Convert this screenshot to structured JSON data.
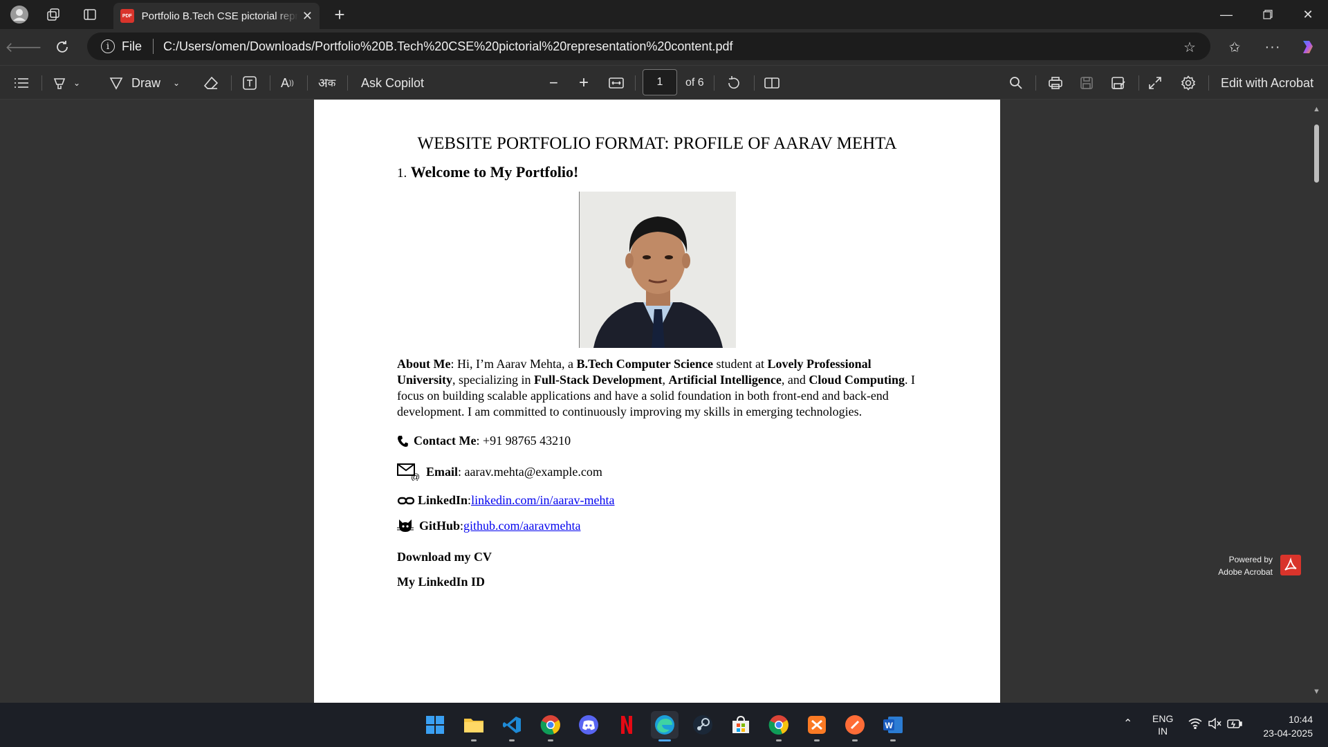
{
  "browser": {
    "tab_title": "Portfolio B.Tech CSE pictorial representation content.pdf",
    "address_scheme": "File",
    "address_url": "C:/Users/omen/Downloads/Portfolio%20B.Tech%20CSE%20pictorial%20representation%20content.pdf"
  },
  "pdf_toolbar": {
    "draw_label": "Draw",
    "ask_copilot_label": "Ask Copilot",
    "page_current": "1",
    "page_total_label": "of 6",
    "edit_acrobat_label": "Edit with Acrobat"
  },
  "document": {
    "title": "WEBSITE PORTFOLIO FORMAT: PROFILE OF AARAV MEHTA",
    "section1_number": "1.",
    "section1_heading": "Welcome to My Portfolio!",
    "about": {
      "label": "About Me",
      "t1": ": Hi, I’m Aarav Mehta, a ",
      "b1": "B.Tech Computer Science",
      "t2": " student at ",
      "b2": "Lovely Professional University",
      "t3": ", specializing in ",
      "b3": "Full-Stack Development",
      "t4": ", ",
      "b4": "Artificial Intelligence",
      "t5": ", and ",
      "b5": "Cloud Computing",
      "t6": ". I focus on building scalable applications and have a solid foundation in both front-end and back-end development. I am committed to continuously improving my skills in emerging technologies."
    },
    "contact": {
      "label": "Contact Me",
      "value": ": +91 98765 43210"
    },
    "email": {
      "label": "Email",
      "value": ": aarav.mehta@example.com"
    },
    "linkedin": {
      "label": "LinkedIn",
      "sep": ": ",
      "link": "linkedin.com/in/aarav-mehta"
    },
    "github": {
      "label": "GitHub",
      "sep": ": ",
      "link": "github.com/aaravmehta"
    },
    "download_cv": "Download my CV",
    "my_linkedin_id": "My LinkedIn ID"
  },
  "powered_by": {
    "line1": "Powered by",
    "line2": "Adobe Acrobat"
  },
  "taskbar": {
    "lang_line1": "ENG",
    "lang_line2": "IN",
    "time": "10:44",
    "date": "23-04-2025"
  },
  "icons": [
    "profile-icon",
    "workspaces-icon",
    "tab-actions-icon",
    "pdf-icon",
    "close-icon",
    "new-tab-icon",
    "back-icon",
    "refresh-icon",
    "info-icon",
    "favorite-star-icon",
    "favorites-icon",
    "more-icon",
    "copilot-icon",
    "contents-icon",
    "highlight-icon",
    "draw-icon",
    "eraser-icon",
    "text-box-icon",
    "read-aloud-icon",
    "translate-icon",
    "zoom-out-icon",
    "zoom-in-icon",
    "fit-page-icon",
    "rotate-icon",
    "page-view-icon",
    "search-icon",
    "print-icon",
    "save-icon",
    "save-as-icon",
    "fullscreen-icon",
    "settings-icon",
    "phone-icon",
    "email-icon",
    "link-icon",
    "cat-icon"
  ]
}
